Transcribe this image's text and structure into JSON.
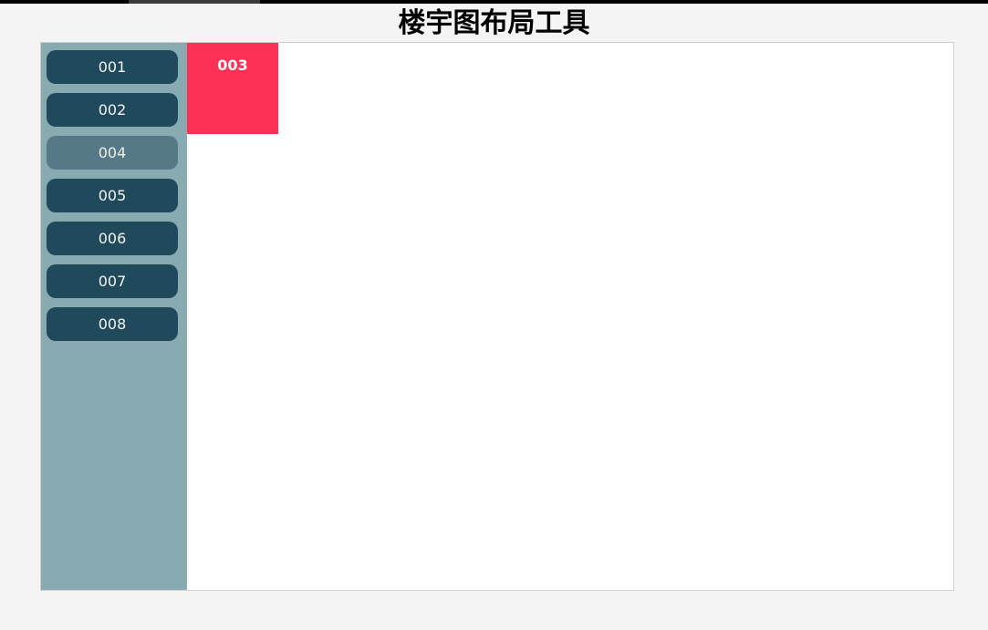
{
  "page": {
    "title": "楼宇图布局工具"
  },
  "sidebar": {
    "items": [
      {
        "label": "001",
        "state": "normal"
      },
      {
        "label": "002",
        "state": "normal"
      },
      {
        "label": "004",
        "state": "muted"
      },
      {
        "label": "005",
        "state": "normal"
      },
      {
        "label": "006",
        "state": "normal"
      },
      {
        "label": "007",
        "state": "normal"
      },
      {
        "label": "008",
        "state": "normal"
      }
    ]
  },
  "canvas": {
    "blocks": [
      {
        "label": "003",
        "color": "#fd3055"
      }
    ]
  },
  "colors": {
    "sidebar_bg": "#87abb0",
    "button_bg": "#204a5c",
    "button_muted_bg": "#557986",
    "block_bg": "#fd3055",
    "page_bg": "#f4f4f4"
  }
}
